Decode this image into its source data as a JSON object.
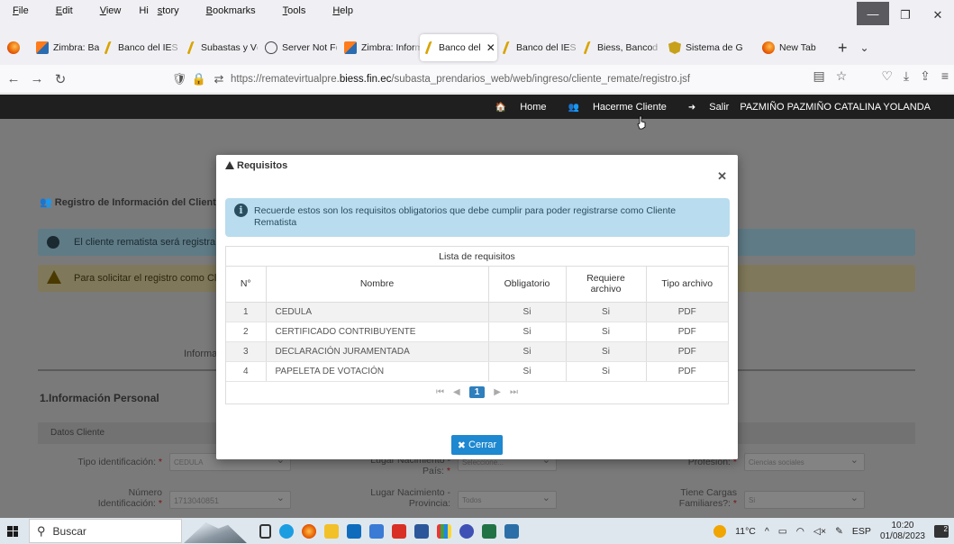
{
  "menubar": {
    "items": [
      {
        "pre": "",
        "acc": "F",
        "post": "ile"
      },
      {
        "pre": "",
        "acc": "E",
        "post": "dit"
      },
      {
        "pre": "",
        "acc": "V",
        "post": "iew"
      },
      {
        "pre": "Hi",
        "acc": "s",
        "post": "tory"
      },
      {
        "pre": "",
        "acc": "B",
        "post": "ookmarks"
      },
      {
        "pre": "",
        "acc": "T",
        "post": "ools"
      },
      {
        "pre": "",
        "acc": "H",
        "post": "elp"
      }
    ]
  },
  "tabs": [
    {
      "label": "Zimbra: Band",
      "fade": "",
      "icon": "zimbra"
    },
    {
      "label": "Banco del IE",
      "fade": "S",
      "icon": "biess"
    },
    {
      "label": "Subastas y V",
      "fade": "e",
      "icon": "biess"
    },
    {
      "label": "Server Not F",
      "fade": "o",
      "icon": "info"
    },
    {
      "label": "Zimbra: Infor",
      "fade": "m",
      "icon": "zimbra"
    },
    {
      "label": "Banco del",
      "fade": "",
      "icon": "biess",
      "active": true,
      "close": "✕"
    },
    {
      "label": "Banco del IE",
      "fade": "S",
      "icon": "biess"
    },
    {
      "label": "Biess, Banco",
      "fade": "d",
      "icon": "biess"
    },
    {
      "label": "Sistema de G",
      "fade": "",
      "icon": "shield"
    },
    {
      "label": "New Tab",
      "fade": "",
      "icon": "firefox"
    }
  ],
  "address": {
    "prefix": "https://rematevirtualpre.",
    "domain": "biess.fin.ec",
    "path": "/subasta_prendarios_web/web/ingreso/cliente_remate/registro.jsf"
  },
  "topnav": {
    "home": "Home",
    "register": "Hacerme Cliente",
    "logout": "Salir",
    "user": "PAZMIÑO PAZMIÑO CATALINA YOLANDA"
  },
  "background": {
    "title": "Registro de Información del Cliente R",
    "alert_info": "El cliente rematista será registra",
    "alert_warn": "Para solicitar el registro como Cl",
    "tab_label": "Informa",
    "section": "1.Información Personal",
    "datos": "Datos Cliente",
    "tipo_id_label": "Tipo identificación:",
    "tipo_id_value": "CEDULA",
    "numero_label_1": "Número",
    "numero_label_2": "Identificación:",
    "numero_value": "1713040851",
    "lugar_pais_1": "Lugar Nacimiento -",
    "lugar_pais_2": "País:",
    "lugar_pais_value": "Seleccione...",
    "lugar_prov_1": "Lugar Nacimiento -",
    "lugar_prov_2": "Provincia:",
    "lugar_prov_value": "Todos",
    "profesion_label": "Profesión:",
    "profesion_value": "Ciencias sociales",
    "cargas_1": "Tiene Cargas",
    "cargas_2": "Familiares?:",
    "cargas_value": "Si",
    "req_mark": "*"
  },
  "modal": {
    "title": "Requisitos",
    "info": "Recuerde estos son los requisitos obligatorios que debe cumplir para poder registrarse como Cliente Rematista",
    "table_caption": "Lista de requisitos",
    "headers": [
      "N°",
      "Nombre",
      "Obligatorio",
      "Requiere archivo",
      "Tipo archivo"
    ],
    "rows": [
      [
        "1",
        "CEDULA",
        "Si",
        "Si",
        "PDF"
      ],
      [
        "2",
        "CERTIFICADO CONTRIBUYENTE",
        "Si",
        "Si",
        "PDF"
      ],
      [
        "3",
        "DECLARACIÓN JURAMENTADA",
        "Si",
        "Si",
        "PDF"
      ],
      [
        "4",
        "PAPELETA DE VOTACIÓN",
        "Si",
        "Si",
        "PDF"
      ]
    ],
    "pager": {
      "first": "⏮",
      "prev": "◀",
      "current": "1",
      "next": "▶",
      "last": "⏭"
    },
    "close_button": "Cerrar"
  },
  "taskbar": {
    "search": "Buscar",
    "weather": "11°C",
    "lang": "ESP",
    "time": "10:20",
    "date": "01/08/2023",
    "notif": "2"
  }
}
